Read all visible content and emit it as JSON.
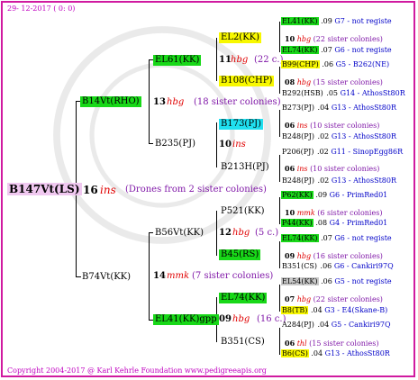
{
  "header_date": "29- 12-2017 ( 0: 0)",
  "footer": "Copyright 2004-2017 @ Karl Kehrle Foundation    www.pedigreeapis.org",
  "root": {
    "name": "B147Vt(LS)",
    "num": "16",
    "mark": "ins",
    "note": "(Drones from 2 sister colonies)"
  },
  "g1": [
    {
      "name": "B14Vt(RHO)",
      "num": "13",
      "mark": "hbg",
      "note": "(18 sister colonies)"
    },
    {
      "name": "B74Vt(KK)",
      "num": "14",
      "mark": "mmk",
      "note": "(7 sister colonies)"
    }
  ],
  "g2": [
    {
      "name": "EL61(KK)",
      "num": "11",
      "mark": "hbg",
      "note": "(22 c.)"
    },
    {
      "name": "B235(PJ)",
      "num": "10",
      "mark": "ins",
      "note": ""
    },
    {
      "name": "B56Vt(KK)",
      "num": "12",
      "mark": "hbg",
      "note": "(5 c.)"
    },
    {
      "name": "EL41(KK)gpp",
      "num": "09",
      "mark": "hbg",
      "note": "(16 c.)"
    }
  ],
  "g3": [
    {
      "name": "EL2(KK)"
    },
    {
      "name": "B108(CHP)"
    },
    {
      "name": "B173(PJ)"
    },
    {
      "name": "B213H(PJ)"
    },
    {
      "name": "P521(KK)"
    },
    {
      "name": "B45(RS)"
    },
    {
      "name": "EL74(KK)"
    },
    {
      "name": "B351(CS)"
    }
  ],
  "g3_drones": [
    {
      "num": "10",
      "mark": "hbg",
      "note": "(22 sister colonies)"
    },
    {
      "num": "08",
      "mark": "hbg",
      "note": "(15 sister colonies)"
    },
    {
      "num": "06",
      "mark": "ins",
      "note": "(10 sister colonies)"
    },
    {
      "num": "06",
      "mark": "ins",
      "note": "(10 sister colonies)"
    },
    {
      "num": "10",
      "mark": "mmk",
      "note": "(6 sister colonies)"
    },
    {
      "num": "09",
      "mark": "hbg",
      "note": "(16 sister colonies)"
    },
    {
      "num": "07",
      "mark": "hbg",
      "note": "(22 sister colonies)"
    },
    {
      "num": "06",
      "mark": "thl",
      "note": "(15 sister colonies)"
    }
  ],
  "g4": [
    {
      "name": "EL41(KK)",
      "val": ".09",
      "info": "G7 - not registe"
    },
    {
      "name": "EL74(KK)",
      "val": ".07",
      "info": "G6 - not registe"
    },
    {
      "name": "B99(CHP)",
      "val": ".06",
      "info": "G5 - B262(NE)"
    },
    {
      "name": "B292(HSB)",
      "val": ".05",
      "info": "G14 - AthosSt80R"
    },
    {
      "name": "B273(PJ)",
      "val": ".04",
      "info": "G13 - AthosSt80R"
    },
    {
      "name": "B248(PJ)",
      "val": ".02",
      "info": "G13 - AthosSt80R"
    },
    {
      "name": "P206(PJ)",
      "val": ".02",
      "info": "G11 - SinopEgg86R"
    },
    {
      "name": "B248(PJ)",
      "val": ".02",
      "info": "G13 - AthosSt80R"
    },
    {
      "name": "P62(KK)",
      "val": ".09",
      "info": "G6 - PrimRed01"
    },
    {
      "name": "P44(KK)",
      "val": ".08",
      "info": "G4 - PrimRed01"
    },
    {
      "name": "EL74(KK)",
      "val": ".07",
      "info": "G6 - not registe"
    },
    {
      "name": "B351(CS)",
      "val": ".06",
      "info": "G6 - Cankiri97Q"
    },
    {
      "name": "EL54(KK)",
      "val": ".06",
      "info": "G5 - not registe"
    },
    {
      "name": "B8(TB)",
      "val": ".04",
      "info": "G3 - E4(Skane-B)"
    },
    {
      "name": "A284(PJ)",
      "val": ".04",
      "info": "G5 - Cankiri97Q"
    },
    {
      "name": "B6(CS)",
      "val": ".04",
      "info": "G13 - AthosSt80R"
    }
  ]
}
